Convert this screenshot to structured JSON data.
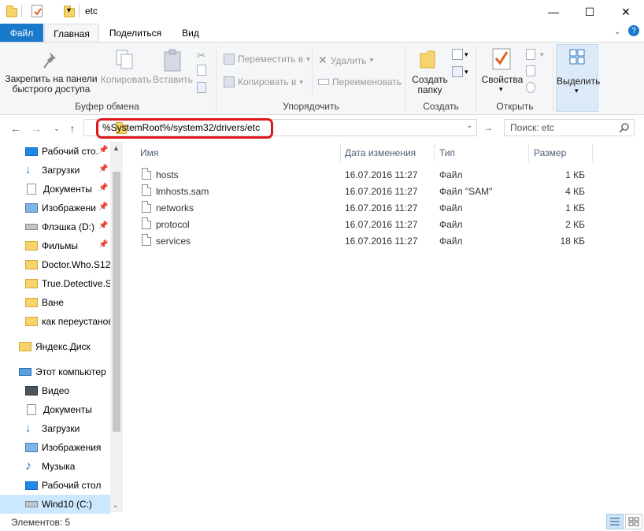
{
  "window": {
    "title": "etc",
    "minimize": "—",
    "maximize": "☐",
    "close": "✕"
  },
  "ribbon_tabs": {
    "file": "Файл",
    "home": "Главная",
    "share": "Поделиться",
    "view": "Вид"
  },
  "ribbon": {
    "clipboard": {
      "pin_label": "Закрепить на панели быстрого доступа",
      "pin_line1": "Закрепить на панели",
      "pin_line2": "быстрого доступа",
      "copy": "Копировать",
      "paste": "Вставить",
      "group": "Буфер обмена"
    },
    "organize": {
      "move_to": "Переместить в",
      "copy_to": "Копировать в",
      "delete": "Удалить",
      "rename": "Переименовать",
      "group": "Упорядочить"
    },
    "new": {
      "new_folder_line1": "Создать",
      "new_folder_line2": "папку",
      "group": "Создать"
    },
    "open": {
      "properties": "Свойства",
      "group": "Открыть"
    },
    "select": {
      "select": "Выделить"
    }
  },
  "address": {
    "path": "%SystemRoot%/system32/drivers/etc",
    "search_placeholder": "Поиск: etc"
  },
  "nav_pane": {
    "quick_access": [
      {
        "label": "Рабочий сто.",
        "icon": "desktop-icon",
        "pinned": true
      },
      {
        "label": "Загрузки",
        "icon": "downloads-icon",
        "pinned": true
      },
      {
        "label": "Документы",
        "icon": "documents-icon",
        "pinned": true
      },
      {
        "label": "Изображени",
        "icon": "pictures-icon",
        "pinned": true
      },
      {
        "label": "Флэшка (D:)",
        "icon": "usb-drive-icon",
        "pinned": true
      },
      {
        "label": "Фильмы",
        "icon": "folder-icon",
        "pinned": true
      },
      {
        "label": "Doctor.Who.S12",
        "icon": "folder-icon",
        "pinned": false
      },
      {
        "label": "True.Detective.S",
        "icon": "folder-icon",
        "pinned": false
      },
      {
        "label": "Ване",
        "icon": "folder-icon",
        "pinned": false
      },
      {
        "label": "как переустанов",
        "icon": "folder-icon",
        "pinned": false
      }
    ],
    "yandex": "Яндекс.Диск",
    "this_pc": "Этот компьютер",
    "pc_items": [
      {
        "label": "Видео",
        "icon": "video-icon"
      },
      {
        "label": "Документы",
        "icon": "documents-icon"
      },
      {
        "label": "Загрузки",
        "icon": "downloads-icon"
      },
      {
        "label": "Изображения",
        "icon": "pictures-icon"
      },
      {
        "label": "Музыка",
        "icon": "music-icon"
      },
      {
        "label": "Рабочий стол",
        "icon": "desktop-icon"
      },
      {
        "label": "Wind10 (C:)",
        "icon": "drive-icon"
      }
    ]
  },
  "columns": {
    "name": "Имя",
    "date": "Дата изменения",
    "type": "Тип",
    "size": "Размер"
  },
  "files": [
    {
      "name": "hosts",
      "date": "16.07.2016 11:27",
      "type": "Файл",
      "size": "1 КБ"
    },
    {
      "name": "lmhosts.sam",
      "date": "16.07.2016 11:27",
      "type": "Файл \"SAM\"",
      "size": "4 КБ"
    },
    {
      "name": "networks",
      "date": "16.07.2016 11:27",
      "type": "Файл",
      "size": "1 КБ"
    },
    {
      "name": "protocol",
      "date": "16.07.2016 11:27",
      "type": "Файл",
      "size": "2 КБ"
    },
    {
      "name": "services",
      "date": "16.07.2016 11:27",
      "type": "Файл",
      "size": "18 КБ"
    }
  ],
  "status": {
    "count": "Элементов: 5"
  },
  "colors": {
    "accent": "#1979ca",
    "highlight": "#e0181b",
    "folder": "#f6d36b"
  }
}
